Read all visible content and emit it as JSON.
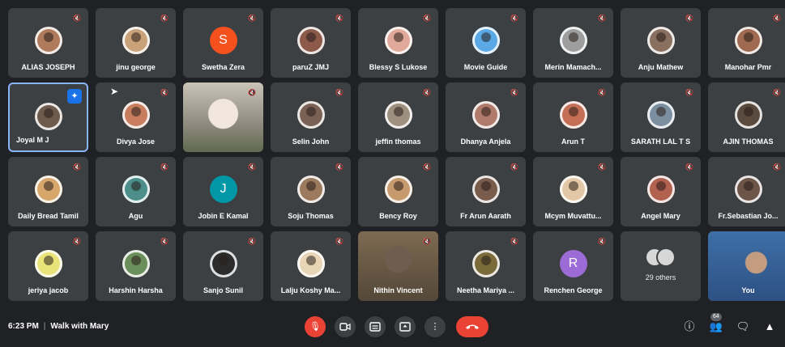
{
  "participants": [
    {
      "name": "ALIAS JOSEPH",
      "avatar_type": "photo",
      "avatar_color": "#b07a5c"
    },
    {
      "name": "jinu george",
      "avatar_type": "photo",
      "avatar_color": "#c9a27a"
    },
    {
      "name": "Swetha Zera",
      "avatar_type": "initial",
      "initial": "S",
      "avatar_color": "#f4511e"
    },
    {
      "name": "paruZ JMJ",
      "avatar_type": "photo",
      "avatar_color": "#8d5a4a"
    },
    {
      "name": "Blessy S Lukose",
      "avatar_type": "photo",
      "avatar_color": "#e0a999"
    },
    {
      "name": "Movie Guide",
      "avatar_type": "photo",
      "avatar_color": "#5aa9e6"
    },
    {
      "name": "Merin Mamach...",
      "avatar_type": "photo",
      "avatar_color": "#9e9e9e"
    },
    {
      "name": "Anju Mathew",
      "avatar_type": "photo",
      "avatar_color": "#8a7060"
    },
    {
      "name": "Manohar Pmr",
      "avatar_type": "photo",
      "avatar_color": "#a06a50"
    },
    {
      "name": "Joyal M J",
      "avatar_type": "photo",
      "avatar_color": "#6f5b4d",
      "selected": true,
      "pinned": true
    },
    {
      "name": "Divya Jose",
      "avatar_type": "photo",
      "avatar_color": "#c87d5e"
    },
    {
      "name": "",
      "avatar_type": "video",
      "scene": "scene1"
    },
    {
      "name": "Selin John",
      "avatar_type": "photo",
      "avatar_color": "#7a6155"
    },
    {
      "name": "jeffin thomas",
      "avatar_type": "photo",
      "avatar_color": "#9e8f7e"
    },
    {
      "name": "Dhanya Anjela",
      "avatar_type": "photo",
      "avatar_color": "#b07b6b"
    },
    {
      "name": "Arun T",
      "avatar_type": "photo",
      "avatar_color": "#c56f56"
    },
    {
      "name": "SARATH LAL T S",
      "avatar_type": "photo",
      "avatar_color": "#7c8fa0"
    },
    {
      "name": "AJIN THOMAS",
      "avatar_type": "photo",
      "avatar_color": "#5b4a3e"
    },
    {
      "name": "Daily Bread Tamil",
      "avatar_type": "photo",
      "avatar_color": "#d7a66a"
    },
    {
      "name": "Agu",
      "avatar_type": "photo",
      "avatar_color": "#4c8f8a"
    },
    {
      "name": "Jobin E Kamal",
      "avatar_type": "initial",
      "initial": "J",
      "avatar_color": "#0097a7"
    },
    {
      "name": "Soju Thomas",
      "avatar_type": "photo",
      "avatar_color": "#9b7a5e"
    },
    {
      "name": "Bency Roy",
      "avatar_type": "photo",
      "avatar_color": "#c89b6e"
    },
    {
      "name": "Fr Arun Aarath",
      "avatar_type": "photo",
      "avatar_color": "#7a5c4c"
    },
    {
      "name": "Mcym Muvattu...",
      "avatar_type": "photo",
      "avatar_color": "#e4c7a6"
    },
    {
      "name": "Angel Mary",
      "avatar_type": "photo",
      "avatar_color": "#b3614f"
    },
    {
      "name": "Fr.Sebastian Jo...",
      "avatar_type": "photo",
      "avatar_color": "#6e5549"
    },
    {
      "name": "jeriya jacob",
      "avatar_type": "photo",
      "avatar_color": "#e9e37a"
    },
    {
      "name": "Harshin Harsha",
      "avatar_type": "photo",
      "avatar_color": "#6b8f5a"
    },
    {
      "name": "Sanjo Sunil",
      "avatar_type": "photo",
      "avatar_color": "#2c2c2c"
    },
    {
      "name": "Lalju Koshy Ma...",
      "avatar_type": "photo",
      "avatar_color": "#e8d5b5"
    },
    {
      "name": "Nithin Vincent",
      "avatar_type": "video",
      "scene": "scene2"
    },
    {
      "name": "Neetha Mariya ...",
      "avatar_type": "photo",
      "avatar_color": "#7b6b3a"
    },
    {
      "name": "Renchen George",
      "avatar_type": "initial",
      "initial": "R",
      "avatar_color": "#9c6bd6"
    },
    {
      "name": "29 others",
      "avatar_type": "others"
    },
    {
      "name": "You",
      "avatar_type": "video",
      "scene": "scene3"
    }
  ],
  "meeting": {
    "time": "6:23 PM",
    "separator": "|",
    "title": "Walk with Mary"
  },
  "controls": {
    "mic_icon": "mic-off-icon",
    "camera_icon": "camera-icon",
    "captions_icon": "captions-icon",
    "present_icon": "present-icon",
    "more_icon": "more-options-icon",
    "end_icon": "end-call-icon"
  },
  "right_controls": {
    "people_count": "64"
  },
  "colors": {
    "background": "#202124",
    "tile": "#3c4043",
    "end_call": "#ea4335",
    "selected_border": "#8ab4f8"
  }
}
